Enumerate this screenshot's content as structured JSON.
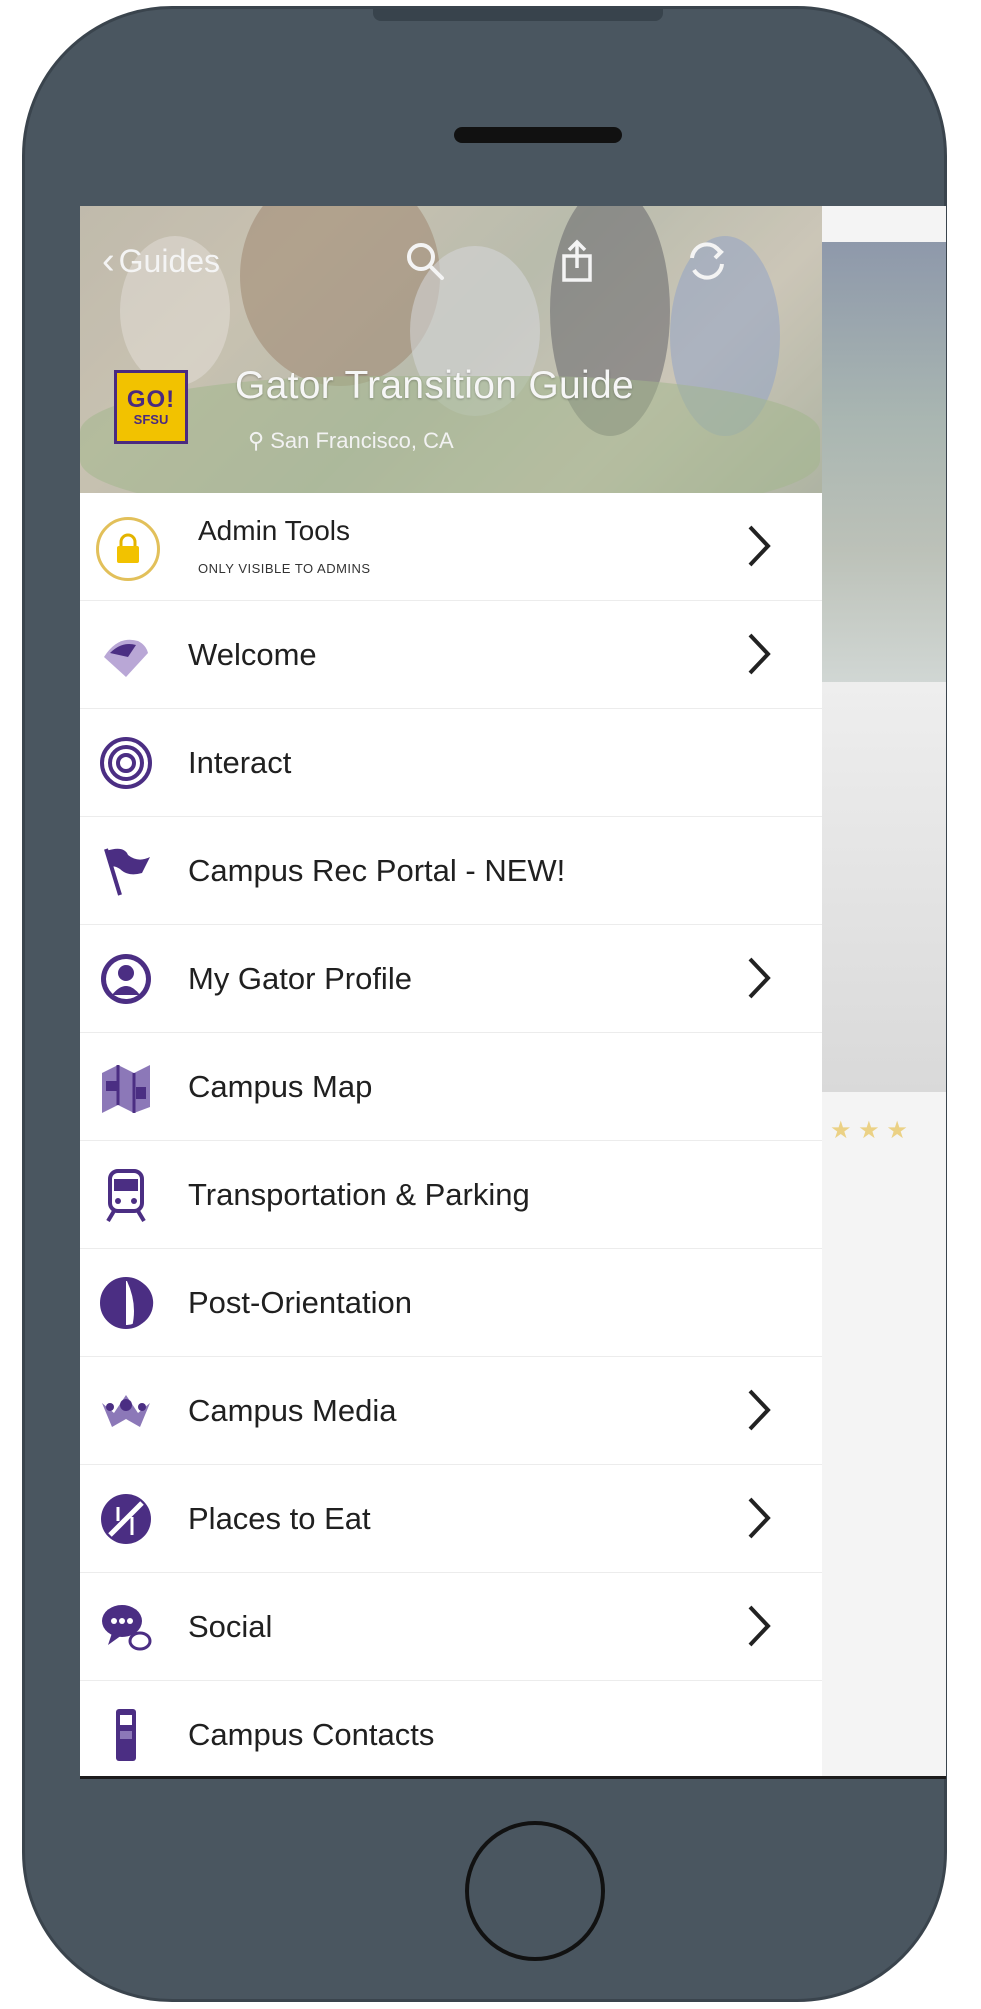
{
  "header": {
    "back_label": "Guides",
    "app_logo_top": "GO!",
    "app_logo_bottom": "SFSU",
    "title": "Gator Transition Guide",
    "location": "San Francisco, CA",
    "icons": [
      "search-icon",
      "share-icon",
      "sync-icon"
    ]
  },
  "menu": {
    "admin": {
      "label": "Admin Tools",
      "sublabel": "ONLY VISIBLE TO ADMINS"
    },
    "items": [
      {
        "label": "Welcome",
        "icon": "welcome-icon",
        "has_chevron": true
      },
      {
        "label": "Interact",
        "icon": "interact-icon",
        "has_chevron": false
      },
      {
        "label": "Campus Rec Portal - NEW!",
        "icon": "flag-icon",
        "has_chevron": false
      },
      {
        "label": "My Gator Profile",
        "icon": "profile-icon",
        "has_chevron": true
      },
      {
        "label": "Campus Map",
        "icon": "map-icon",
        "has_chevron": false
      },
      {
        "label": "Transportation & Parking",
        "icon": "train-icon",
        "has_chevron": false
      },
      {
        "label": "Post-Orientation",
        "icon": "half-circle-icon",
        "has_chevron": false
      },
      {
        "label": "Campus Media",
        "icon": "media-icon",
        "has_chevron": true
      },
      {
        "label": "Places to Eat",
        "icon": "no-food-icon",
        "has_chevron": true
      },
      {
        "label": "Social",
        "icon": "chat-icon",
        "has_chevron": true
      },
      {
        "label": "Campus Contacts",
        "icon": "phone-icon",
        "has_chevron": false
      }
    ]
  },
  "peek": {
    "rating_stars": "★ ★ ★"
  },
  "colors": {
    "accent": "#4b2e83",
    "gold": "#f2c200",
    "frame": "#4a5660"
  }
}
